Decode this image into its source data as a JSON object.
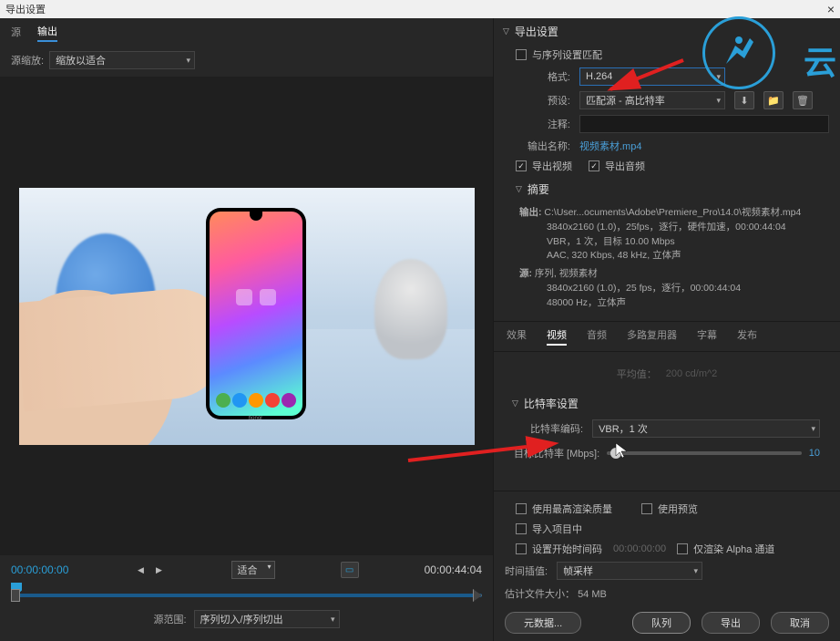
{
  "title": "导出设置",
  "left": {
    "tabs": {
      "source": "源",
      "output": "输出"
    },
    "scale_label": "源缩放:",
    "scale_value": "缩放以适合",
    "timecode_in": "00:00:00:00",
    "timecode_out": "00:00:44:04",
    "fit_value": "适合",
    "range_label": "源范围:",
    "range_value": "序列切入/序列切出",
    "phone_brand": "honor"
  },
  "export": {
    "header": "导出设置",
    "match_seq": "与序列设置匹配",
    "format_label": "格式:",
    "format_value": "H.264",
    "preset_label": "预设:",
    "preset_value": "匹配源 - 高比特率",
    "comment_label": "注释:",
    "comment_value": "",
    "outname_label": "输出名称:",
    "outname_value": "视频素材.mp4",
    "export_video": "导出视频",
    "export_audio": "导出音频"
  },
  "summary": {
    "header": "摘要",
    "out_label": "输出:",
    "out_path": "C:\\User...ocuments\\Adobe\\Premiere_Pro\\14.0\\视频素材.mp4",
    "out_line2": "3840x2160 (1.0)，25fps，逐行，硬件加速，00:00:44:04",
    "out_line3": "VBR，1 次，目标 10.00 Mbps",
    "out_line4": "AAC, 320 Kbps, 48 kHz, 立体声",
    "src_label": "源:",
    "src_line1": "序列, 视频素材",
    "src_line2": "3840x2160 (1.0)，25 fps，逐行，00:00:44:04",
    "src_line3": "48000 Hz，立体声"
  },
  "tabs2": {
    "effects": "效果",
    "video": "视频",
    "audio": "音频",
    "mux": "多路复用器",
    "caption": "字幕",
    "publish": "发布"
  },
  "video": {
    "avg_label": "平均值：",
    "avg_value": "200 cd/m^2",
    "bitrate_header": "比特率设置",
    "encoding_label": "比特率编码:",
    "encoding_value": "VBR，1 次",
    "target_label": "目标比特率 [Mbps]:",
    "target_value": "10"
  },
  "footer": {
    "max_quality": "使用最高渲染质量",
    "use_preview": "使用预览",
    "import_proj": "导入项目中",
    "set_start_tc": "设置开始时间码",
    "start_tc_value": "00:00:00:00",
    "alpha_only": "仅渲染 Alpha 通道",
    "interp_label": "时间插值:",
    "interp_value": "帧采样",
    "est_label": "估计文件大小：",
    "est_value": "54 MB",
    "metadata": "元数据...",
    "queue": "队列",
    "export": "导出",
    "cancel": "取消"
  },
  "watermark": "云"
}
